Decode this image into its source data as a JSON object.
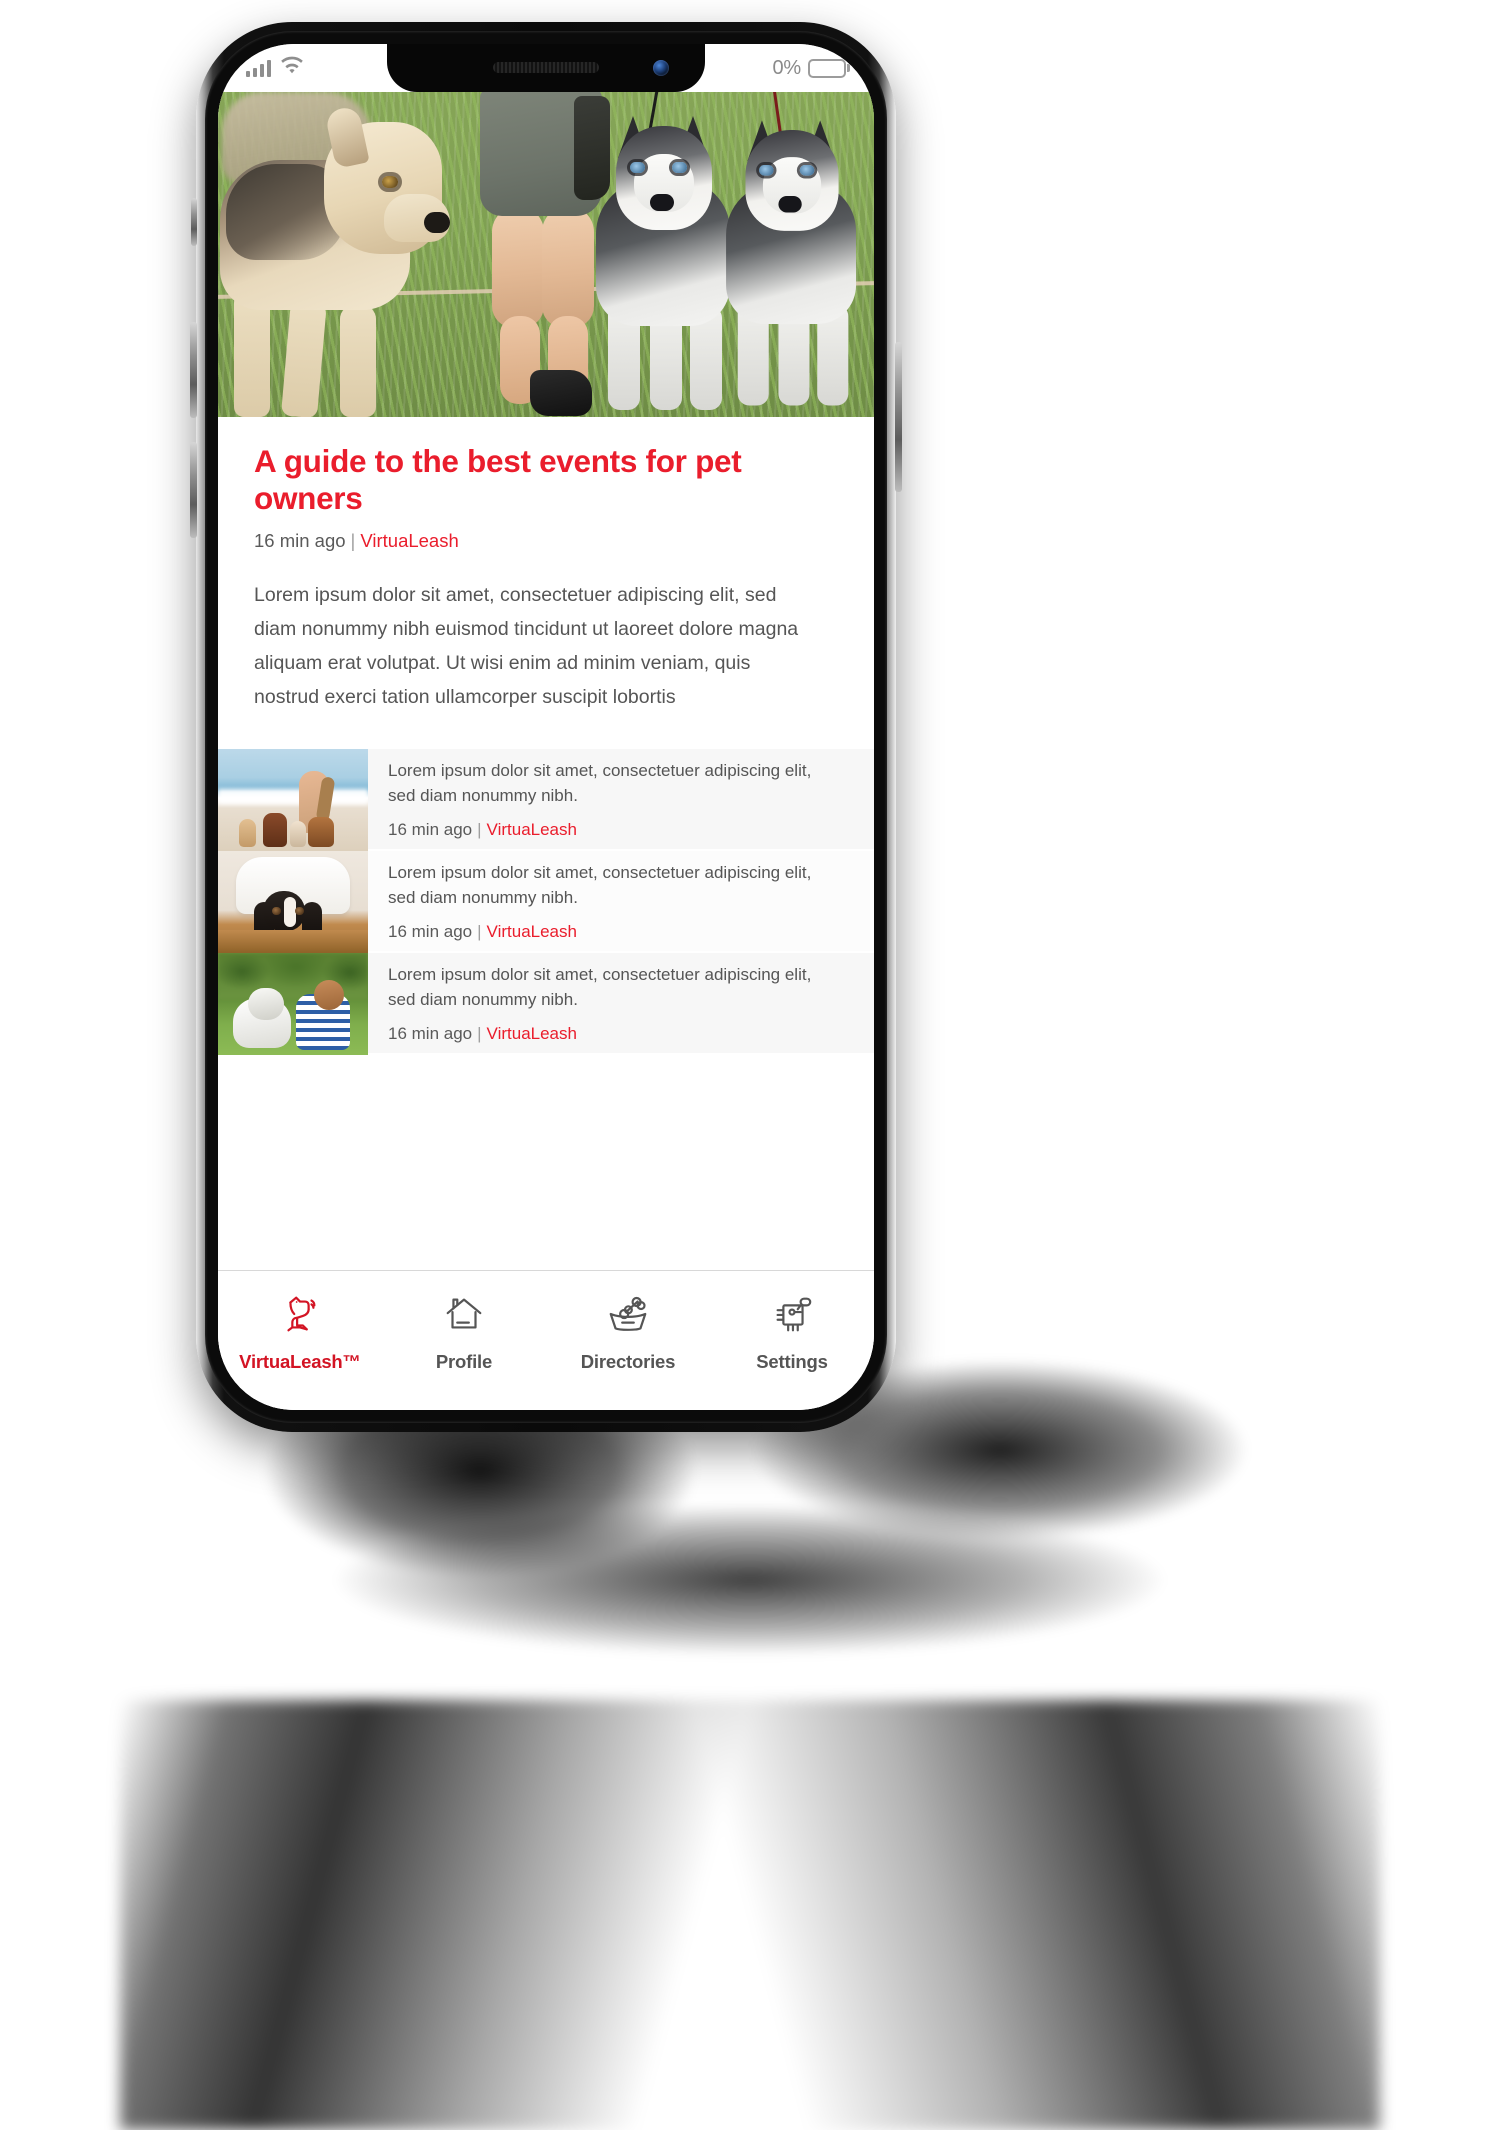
{
  "device": {
    "status_bar": {
      "signal_icon": "cellular-signal-icon",
      "wifi_icon": "wifi-icon",
      "battery_percent": "0%",
      "battery_icon": "battery-icon"
    }
  },
  "hero": {
    "image_alt": "Dogs walking on grass beside a person at an outdoor pet event",
    "image_name": "article-hero-photo"
  },
  "article": {
    "headline": "A guide to the best events for pet owners",
    "time_ago": "16 min ago",
    "separator": "|",
    "source": "VirtuaLeash",
    "body": "Lorem ipsum dolor sit amet, consectetuer adipiscing elit, sed diam nonummy nibh euismod tincidunt ut laoreet dolore magna aliquam erat volutpat. Ut wisi enim ad minim veniam, quis nostrud exerci tation ullamcorper suscipit lobortis"
  },
  "list": {
    "items": [
      {
        "title": "Lorem ipsum dolor sit amet, consectetuer adipiscing elit, sed diam nonummy nibh.",
        "time_ago": "16 min ago",
        "separator": "|",
        "source": "VirtuaLeash",
        "thumb_alt": "Woman sitting on the beach with four small dogs",
        "thumb_name": "list-thumb-beach"
      },
      {
        "title": "Lorem ipsum dolor sit amet, consectetuer adipiscing elit, sed diam nonummy nibh.",
        "time_ago": "16 min ago",
        "separator": "|",
        "source": "VirtuaLeash",
        "thumb_alt": "Cavalier King Charles spaniel peeking over a table in front of a white chair",
        "thumb_name": "list-thumb-spaniel"
      },
      {
        "title": "Lorem ipsum dolor sit amet, consectetuer adipiscing elit, sed diam nonummy nibh.",
        "time_ago": "16 min ago",
        "separator": "|",
        "source": "VirtuaLeash",
        "thumb_alt": "Boy in a striped shirt lying on grass next to a white dog",
        "thumb_name": "list-thumb-boy-dog"
      }
    ]
  },
  "tabbar": {
    "tabs": [
      {
        "label": "VirtuaLeash™",
        "icon": "dog-logo-icon",
        "active": true
      },
      {
        "label": "Profile",
        "icon": "house-icon",
        "active": false
      },
      {
        "label": "Directories",
        "icon": "dog-bowl-bone-icon",
        "active": false
      },
      {
        "label": "Settings",
        "icon": "chip-icon",
        "active": false
      }
    ]
  },
  "colors": {
    "brand_red": "#ea1d2c",
    "tab_active_red": "#d31424",
    "text_gray": "#555555",
    "row_bg": "#f7f7f7"
  }
}
